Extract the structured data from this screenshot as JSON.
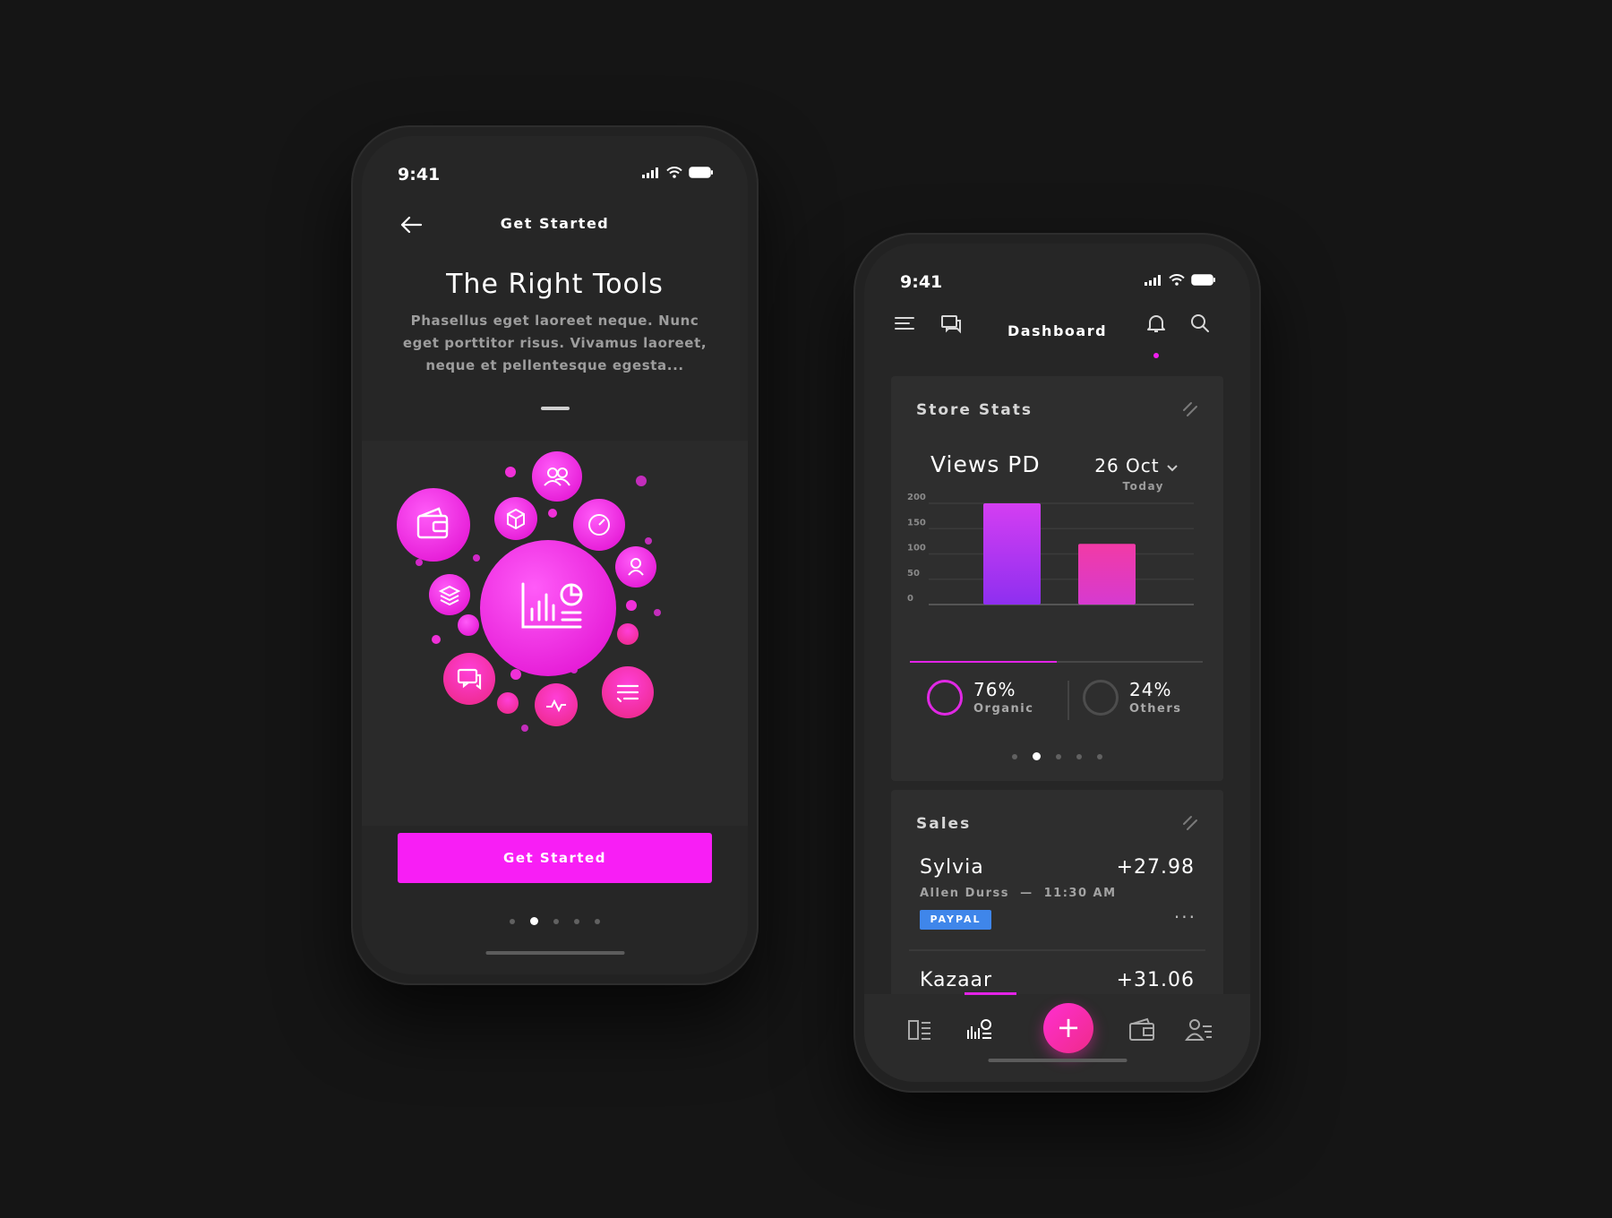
{
  "phone1": {
    "status_time": "9:41",
    "nav_title": "Get Started",
    "heading": "The Right Tools",
    "description": "Phasellus eget laoreet neque. Nunc eget porttitor risus. Vivamus laoreet, neque et pellentesque egesta...",
    "cta_label": "Get Started",
    "pagination": {
      "count": 5,
      "active": 1
    },
    "accent_color": "#f81ef5"
  },
  "phone2": {
    "status_time": "9:41",
    "nav_title": "Dashboard",
    "store_stats": {
      "title": "Store Stats",
      "metric_label": "Views PD",
      "date": "26 Oct",
      "date_sub": "Today",
      "organic_pct": "76%",
      "organic_label": "Organic",
      "others_pct": "24%",
      "others_label": "Others",
      "pagination": {
        "count": 5,
        "active": 1
      }
    },
    "sales": {
      "title": "Sales",
      "items": [
        {
          "name": "Sylvia",
          "amount": "+27.98",
          "customer": "Allen Durss",
          "time": "11:30 AM",
          "badge": "PAYPAL"
        },
        {
          "name": "Kazaar",
          "amount": "+31.06"
        }
      ]
    },
    "tabs": [
      "dashboard-icon",
      "stats-icon",
      "add-icon",
      "wallet-icon",
      "contacts-icon"
    ],
    "active_tab": 1
  },
  "chart_data": {
    "type": "bar",
    "categories": [
      "",
      ""
    ],
    "values": [
      200,
      120
    ],
    "ylim": [
      0,
      200
    ],
    "yticks": [
      200,
      150,
      100,
      50,
      0
    ],
    "grid": true,
    "colors": [
      "#b036f2",
      "#f13aa4"
    ]
  }
}
